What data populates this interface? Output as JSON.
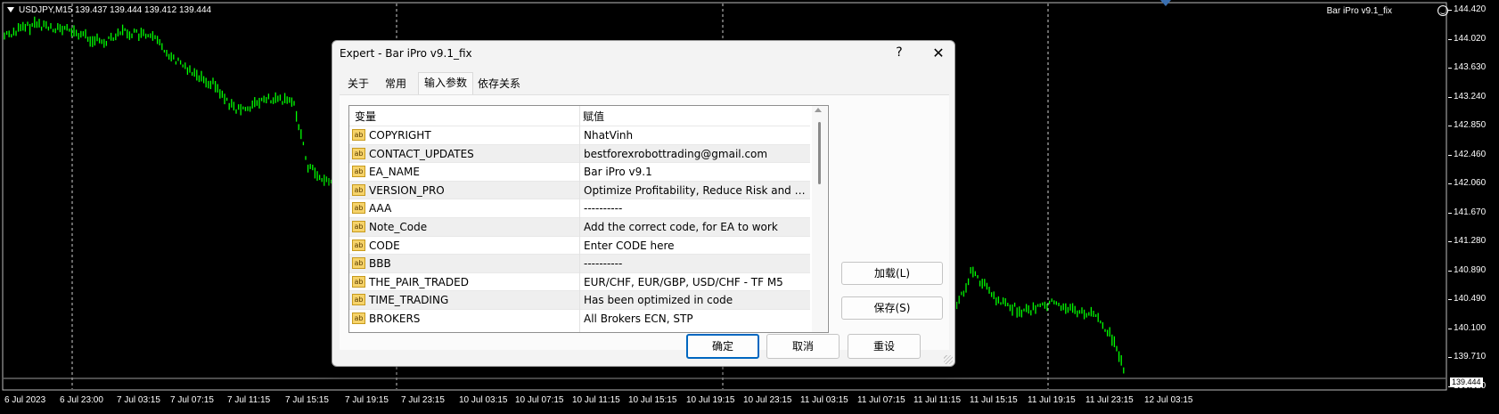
{
  "chart": {
    "symbol_line": "USDJPY,M15  139.437 139.444 139.412 139.444",
    "ea_name": "Bar iPro v9.1_fix",
    "current_price": "139.444",
    "line_color": "#00ff00",
    "price_ticks": [
      "144.420",
      "144.020",
      "143.630",
      "143.240",
      "142.850",
      "142.460",
      "142.060",
      "141.670",
      "141.280",
      "140.890",
      "140.490",
      "140.100",
      "139.710",
      "139.320"
    ],
    "time_ticks": [
      "6 Jul 2023",
      "6 Jul 23:00",
      "7 Jul 03:15",
      "7 Jul 07:15",
      "7 Jul 11:15",
      "7 Jul 15:15",
      "7 Jul 19:15",
      "7 Jul 23:15",
      "10 Jul 03:15",
      "10 Jul 07:15",
      "10 Jul 11:15",
      "10 Jul 15:15",
      "10 Jul 19:15",
      "10 Jul 23:15",
      "11 Jul 03:15",
      "11 Jul 07:15",
      "11 Jul 11:15",
      "11 Jul 15:15",
      "11 Jul 19:15",
      "11 Jul 23:15",
      "12 Jul 03:15"
    ]
  },
  "dialog": {
    "title": "Expert - Bar iPro v9.1_fix",
    "help": "?",
    "close": "✕",
    "tabs": [
      "关于",
      "常用",
      "输入参数",
      "依存关系"
    ],
    "active_tab": "输入参数",
    "columns": [
      "变量",
      "赋值"
    ],
    "params": [
      {
        "name": "COPYRIGHT",
        "value": "NhatVinh"
      },
      {
        "name": "CONTACT_UPDATES",
        "value": "bestforexrobottrading@gmail.com"
      },
      {
        "name": "EA_NAME",
        "value": "Bar iPro v9.1"
      },
      {
        "name": "VERSION_PRO",
        "value": "Optimize Profitability, Reduce Risk and Tr..."
      },
      {
        "name": "AAA",
        "value": "----------"
      },
      {
        "name": "Note_Code",
        "value": "Add the correct code, for EA to work"
      },
      {
        "name": "CODE",
        "value": "Enter CODE here"
      },
      {
        "name": "BBB",
        "value": "----------"
      },
      {
        "name": "THE_PAIR_TRADED",
        "value": "EUR/CHF, EUR/GBP, USD/CHF - TF M5"
      },
      {
        "name": "TIME_TRADING",
        "value": "Has been optimized in code"
      },
      {
        "name": "BROKERS",
        "value": "All Brokers ECN, STP"
      }
    ],
    "ab_icon": "ab",
    "buttons": {
      "load": "加载(L)",
      "save": "保存(S)",
      "ok": "确定",
      "cancel": "取消",
      "reset": "重设"
    }
  }
}
